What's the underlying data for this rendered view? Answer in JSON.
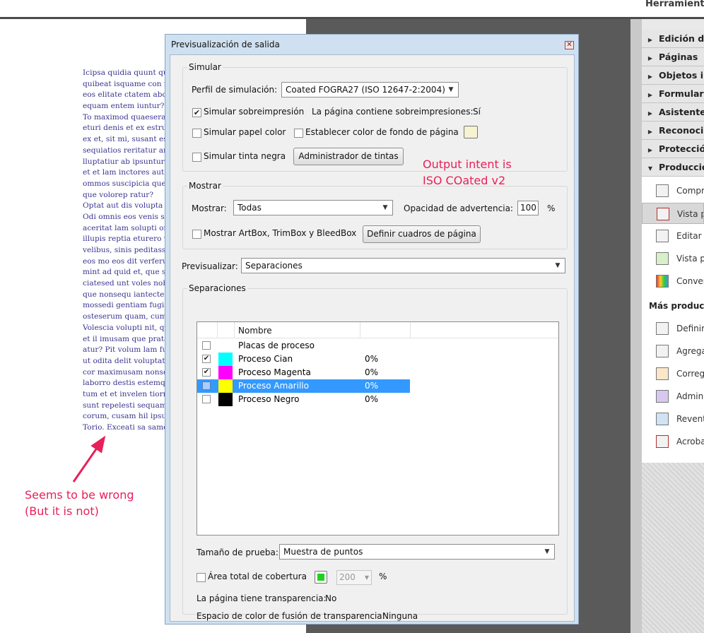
{
  "app": {
    "tools_panel_title": "Herramientas"
  },
  "document_page": {
    "lines": [
      "Icipsa quidia quunt qu",
      "quibeat isquame con m",
      "eos elitate ctatem abor",
      "equam entem iuntur?",
      "To maximod quaesera",
      "eturi denis et ex estrun",
      "ex et, sit mi, susant ess",
      "sequiatios reritatur am",
      "lluptatiur ab ipsuntur s",
      "et et lam inctores aut a",
      "ommos suscipicia que",
      "que volorep ratur?",
      "Optat aut dis volupta i",
      "Odi omnis eos venis se",
      "aceritat lam solupti ore",
      "illupis reptia eturero vi",
      "velibus, sinis peditassi",
      "eos mo eos dit verferu",
      "mint ad quid et, que se",
      "ciatesed unt voles nobi",
      "que nonsequ iantecten",
      "mossedi gentiam fugia",
      "osteserum quam, cum",
      "Volescia volupti nit, qu",
      "et il imusam que prata",
      "atur? Pit volum lam fu",
      "ut odita delit voluptati",
      "cor maximusam nonse",
      "laborro destis estemqu",
      "tum et et invelen tiorr",
      "sunt repelesti sequam,",
      "corum, cusam hil ipsu",
      "Torio. Exceati sa samet"
    ]
  },
  "annotations": {
    "left": [
      "Seems to be wrong",
      "(But it is not)"
    ],
    "right": [
      "Output intent is",
      "ISO COated v2"
    ],
    "color": "#e8205a"
  },
  "tools_panel": {
    "sections": [
      "Edición de",
      "Páginas",
      "Objetos in",
      "Formularie",
      "Asistente d",
      "Reconocim",
      "Protección",
      "Producción"
    ],
    "production_items": [
      "Compro",
      "Vista pr",
      "Editar o",
      "Vista pr",
      "Conver"
    ],
    "more_title": "Más producció",
    "more_items": [
      "Definir c",
      "Agrega",
      "Corregi",
      "Admini",
      "Reventa",
      "Acrobat"
    ]
  },
  "dialog": {
    "title": "Previsualización de salida",
    "simular": {
      "group_label": "Simular",
      "profile_label": "Perfil de simulación:",
      "profile_value": "Coated FOGRA27 (ISO 12647-2:2004)",
      "simulate_overprint": "Simular sobreimpresión",
      "page_has_overprints_label": "La página contiene sobreimpresiones:",
      "page_has_overprints_value": "Sí",
      "simulate_paper_color": "Simular papel color",
      "set_page_background": "Establecer color de fondo de página",
      "simulate_black_ink": "Simular tinta negra",
      "ink_manager_button": "Administrador de tintas"
    },
    "mostrar": {
      "group_label": "Mostrar",
      "show_label": "Mostrar:",
      "show_value": "Todas",
      "warning_opacity_label": "Opacidad de advertencia:",
      "warning_opacity_value": "100",
      "percent": "%",
      "show_boxes": "Mostrar ArtBox, TrimBox y BleedBox",
      "define_boxes_button": "Definir cuadros de página"
    },
    "preview": {
      "label": "Previsualizar:",
      "value": "Separaciones"
    },
    "separaciones": {
      "group_label": "Separaciones",
      "column_name": "Nombre",
      "rows": [
        {
          "name": "Placas de proceso",
          "value": "",
          "checked": false,
          "color": ""
        },
        {
          "name": "Proceso Cian",
          "value": "0%",
          "checked": true,
          "color": "#00ffff"
        },
        {
          "name": "Proceso Magenta",
          "value": "0%",
          "checked": true,
          "color": "#ff00ff"
        },
        {
          "name": "Proceso Amarillo",
          "value": "0%",
          "checked": false,
          "color": "#ffff00"
        },
        {
          "name": "Proceso Negro",
          "value": "0%",
          "checked": false,
          "color": "#000000"
        }
      ],
      "sample_size_label": "Tamaño de prueba:",
      "sample_size_value": "Muestra de puntos",
      "total_coverage_label": "Área total de cobertura",
      "total_coverage_value": "200",
      "total_coverage_unit": "%",
      "transparency_label": "La página tiene transparencia:",
      "transparency_value": "No",
      "blend_space_label": "Espacio de color de fusión de transparencia:",
      "blend_space_value": "Ninguna"
    }
  }
}
